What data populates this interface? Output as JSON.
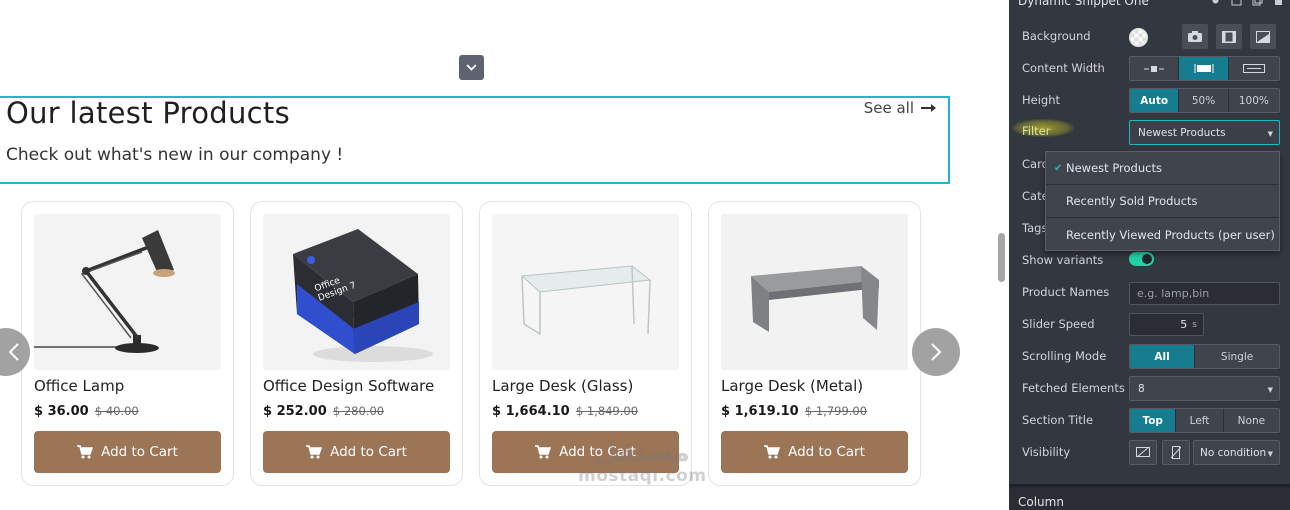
{
  "section": {
    "title": "Our latest Products",
    "subtitle": "Check out what's new in our company !",
    "see_all": "See all"
  },
  "products": [
    {
      "name": "Office Lamp",
      "price": "$ 36.00",
      "old_price": "$ 40.00",
      "button": "Add to Cart"
    },
    {
      "name": "Office Design Software",
      "price": "$ 252.00",
      "old_price": "$ 280.00",
      "button": "Add to Cart",
      "box_text": "Office Design 7"
    },
    {
      "name": "Large Desk (Glass)",
      "price": "$ 1,664.10",
      "old_price": "$ 1,849.00",
      "button": "Add to Cart"
    },
    {
      "name": "Large Desk (Metal)",
      "price": "$ 1,619.10",
      "old_price": "$ 1,799.00",
      "button": "Add to Cart"
    }
  ],
  "watermark": {
    "arabic": "مستقل",
    "latin": "mostaql.com"
  },
  "panel": {
    "title": "Dynamic Snippet One",
    "footer_title": "Column",
    "background_label": "Background",
    "content_width_label": "Content Width",
    "height_label": "Height",
    "height_options": [
      "Auto",
      "50%",
      "100%"
    ],
    "filter_label": "Filter",
    "filter_value": "Newest Products",
    "card_label": "Card",
    "category_label": "Cate",
    "tags_label": "Tags",
    "filter_options": [
      "Newest Products",
      "Recently Sold Products",
      "Recently Viewed Products (per user)"
    ],
    "show_variants_label": "Show variants",
    "show_variants_on": true,
    "product_names_label": "Product Names",
    "product_names_placeholder": "e.g. lamp,bin",
    "slider_speed_label": "Slider Speed",
    "slider_speed_value": "5",
    "slider_speed_unit": "s",
    "scrolling_mode_label": "Scrolling Mode",
    "scrolling_mode_options": [
      "All",
      "Single"
    ],
    "fetched_elements_label": "Fetched Elements",
    "fetched_elements_value": "8",
    "section_title_label": "Section Title",
    "section_title_options": [
      "Top",
      "Left",
      "None"
    ],
    "visibility_label": "Visibility",
    "visibility_value": "No condition"
  },
  "colors": {
    "accent": "#21b6c9",
    "active_button": "#167c8f",
    "cart_button": "#9c7456",
    "panel_bg": "#33373f",
    "toggle_on": "#1ed4a4"
  }
}
